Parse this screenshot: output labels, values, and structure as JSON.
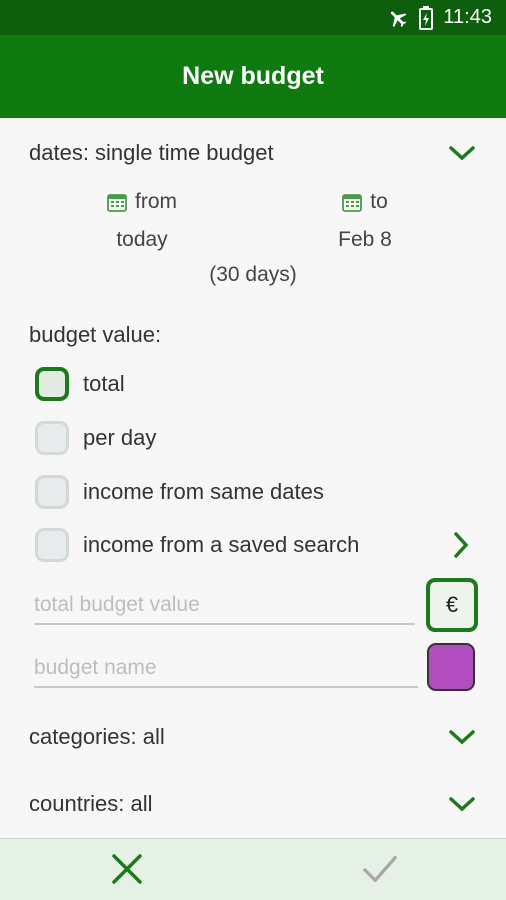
{
  "status_bar": {
    "time": "11:43",
    "icons": [
      "airplane-icon",
      "battery-charging-icon"
    ]
  },
  "app_bar": {
    "title": "New budget"
  },
  "dates": {
    "label": "dates: single time budget",
    "from_label": "from",
    "from_value": "today",
    "to_label": "to",
    "to_value": "Feb 8",
    "duration": "(30 days)"
  },
  "budget_value": {
    "label": "budget value:",
    "options": [
      {
        "label": "total",
        "selected": true
      },
      {
        "label": "per day",
        "selected": false
      },
      {
        "label": "income from same dates",
        "selected": false
      },
      {
        "label": "income from a saved search",
        "selected": false
      }
    ]
  },
  "fields": {
    "total_placeholder": "total budget value",
    "name_placeholder": "budget name",
    "currency_symbol": "€",
    "budget_color": "#b24dbf"
  },
  "filters": {
    "categories": "categories: all",
    "countries": "countries: all"
  },
  "colors": {
    "primary": "#0f7a0f",
    "primary_dark": "#0d5f0d",
    "accent_green": "#1b7a1b"
  }
}
